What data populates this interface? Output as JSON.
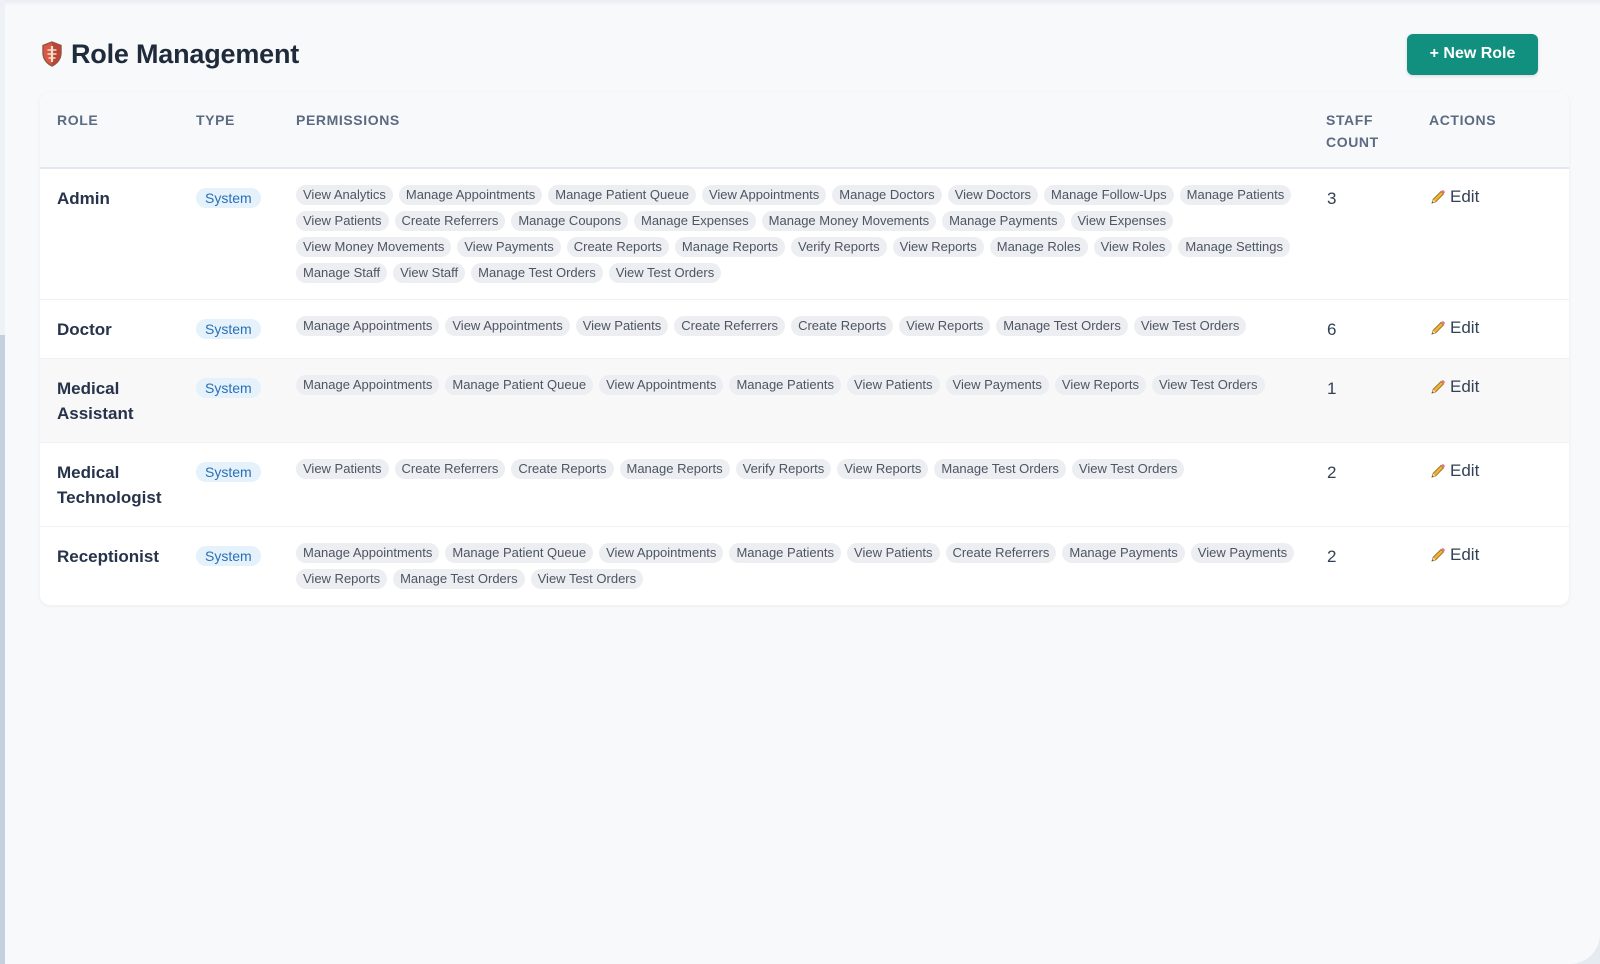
{
  "header": {
    "title": "Role Management",
    "title_icon": "shield-icon",
    "new_role_label": "+ New Role"
  },
  "colors": {
    "accent": "#119080",
    "badge_bg": "#e5f1fb",
    "badge_text": "#2870b8",
    "chip_bg": "#eceef1"
  },
  "table": {
    "columns": {
      "role": "ROLE",
      "type": "TYPE",
      "permissions": "PERMISSIONS",
      "staff_count": "STAFF COUNT",
      "actions": "ACTIONS"
    },
    "rows": [
      {
        "role": "Admin",
        "type": "System",
        "staff_count": "3",
        "action_label": "Edit",
        "permissions": [
          "View Analytics",
          "Manage Appointments",
          "Manage Patient Queue",
          "View Appointments",
          "Manage Doctors",
          "View Doctors",
          "Manage Follow-Ups",
          "Manage Patients",
          "View Patients",
          "Create Referrers",
          "Manage Coupons",
          "Manage Expenses",
          "Manage Money Movements",
          "Manage Payments",
          "View Expenses",
          "View Money Movements",
          "View Payments",
          "Create Reports",
          "Manage Reports",
          "Verify Reports",
          "View Reports",
          "Manage Roles",
          "View Roles",
          "Manage Settings",
          "Manage Staff",
          "View Staff",
          "Manage Test Orders",
          "View Test Orders"
        ]
      },
      {
        "role": "Doctor",
        "type": "System",
        "staff_count": "6",
        "action_label": "Edit",
        "permissions": [
          "Manage Appointments",
          "View Appointments",
          "View Patients",
          "Create Referrers",
          "Create Reports",
          "View Reports",
          "Manage Test Orders",
          "View Test Orders"
        ]
      },
      {
        "role": "Medical Assistant",
        "type": "System",
        "staff_count": "1",
        "action_label": "Edit",
        "permissions": [
          "Manage Appointments",
          "Manage Patient Queue",
          "View Appointments",
          "Manage Patients",
          "View Patients",
          "View Payments",
          "View Reports",
          "View Test Orders"
        ]
      },
      {
        "role": "Medical Technologist",
        "type": "System",
        "staff_count": "2",
        "action_label": "Edit",
        "permissions": [
          "View Patients",
          "Create Referrers",
          "Create Reports",
          "Manage Reports",
          "Verify Reports",
          "View Reports",
          "Manage Test Orders",
          "View Test Orders"
        ]
      },
      {
        "role": "Receptionist",
        "type": "System",
        "staff_count": "2",
        "action_label": "Edit",
        "permissions": [
          "Manage Appointments",
          "Manage Patient Queue",
          "View Appointments",
          "Manage Patients",
          "View Patients",
          "Create Referrers",
          "Manage Payments",
          "View Payments",
          "View Reports",
          "Manage Test Orders",
          "View Test Orders"
        ]
      }
    ]
  }
}
